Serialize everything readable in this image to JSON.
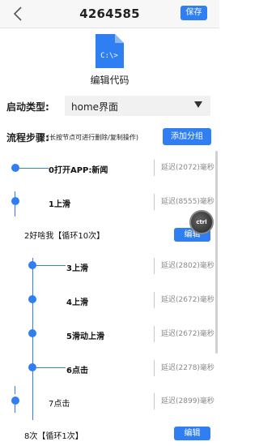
{
  "header": {
    "title": "4264585",
    "save_label": "保存"
  },
  "file": {
    "icon_text": "C:\\>",
    "label": "编辑代码"
  },
  "start_type": {
    "label": "启动类型:",
    "value": "home界面"
  },
  "steps": {
    "title": "流程步骤:",
    "hint": "(长按节点可进行删除/复制操作)",
    "add_group_label": "添加分组"
  },
  "items": [
    {
      "name": "0打开APP:新闻",
      "delay": "延迟(2072)毫秒"
    },
    {
      "name": "1上滑",
      "delay": "延迟(8555)毫秒"
    },
    {
      "group": "2好啥我【循环10次】",
      "edit": "编辑"
    },
    {
      "name": "3上滑",
      "delay": "延迟(2802)毫秒"
    },
    {
      "name": "4上滑",
      "delay": "延迟(2672)毫秒"
    },
    {
      "name": "5滑动上滑",
      "delay": "延迟(2672)毫秒"
    },
    {
      "name": "6点击",
      "delay": "延迟(2278)毫秒"
    },
    {
      "name": "7点击",
      "delay": "延迟(2899)毫秒"
    },
    {
      "group": "8次【循环1次】",
      "edit": "编辑"
    }
  ],
  "bubble_text": "ctrl",
  "colors": {
    "accent": "#2f7ef2"
  }
}
